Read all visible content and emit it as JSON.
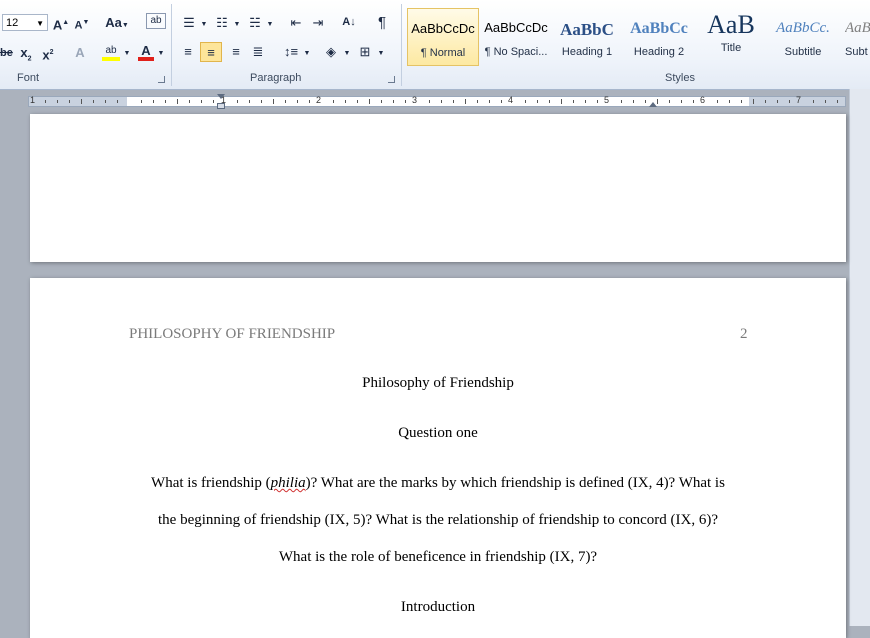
{
  "ribbon": {
    "font_size": "12",
    "case_label": "Aa",
    "font_group_label": "Font",
    "paragraph_group_label": "Paragraph",
    "styles_group_label": "Styles",
    "pilcrow": "¶",
    "styles": [
      {
        "preview": "AaBbCcDc",
        "name": "¶ Normal",
        "selected": true
      },
      {
        "preview": "AaBbCcDc",
        "name": "¶ No Spaci..."
      },
      {
        "preview": "AaBbC",
        "name": "Heading 1"
      },
      {
        "preview": "AaBbCc",
        "name": "Heading 2"
      },
      {
        "preview": "AaB",
        "name": "Title"
      },
      {
        "preview": "AaBbCc.",
        "name": "Subtitle"
      },
      {
        "preview": "AaB",
        "name": "Subt"
      }
    ],
    "colors": {
      "highlight": "#ffff00",
      "font_color": "#e0201a",
      "accent": "#2b579a"
    }
  },
  "ruler": {
    "numbers": [
      "1",
      "1",
      "2",
      "3",
      "4",
      "5",
      "6",
      "7"
    ]
  },
  "document": {
    "header_text": "PHILOSOPHY OF FRIENDSHIP",
    "page_number": "2",
    "title": "Philosophy of Friendship",
    "question_heading": "Question one",
    "para_line1_before": "What is friendship (",
    "para_line1_misspelled": "philia",
    "para_line1_after": ")? What are the marks by which friendship is defined (IX, 4)? What is",
    "para_line2": "the beginning of friendship (IX, 5)? What is the relationship of friendship to concord (IX, 6)?",
    "para_line3": "What is the role of beneficence in friendship (IX, 7)?",
    "intro_heading": "Introduction"
  }
}
